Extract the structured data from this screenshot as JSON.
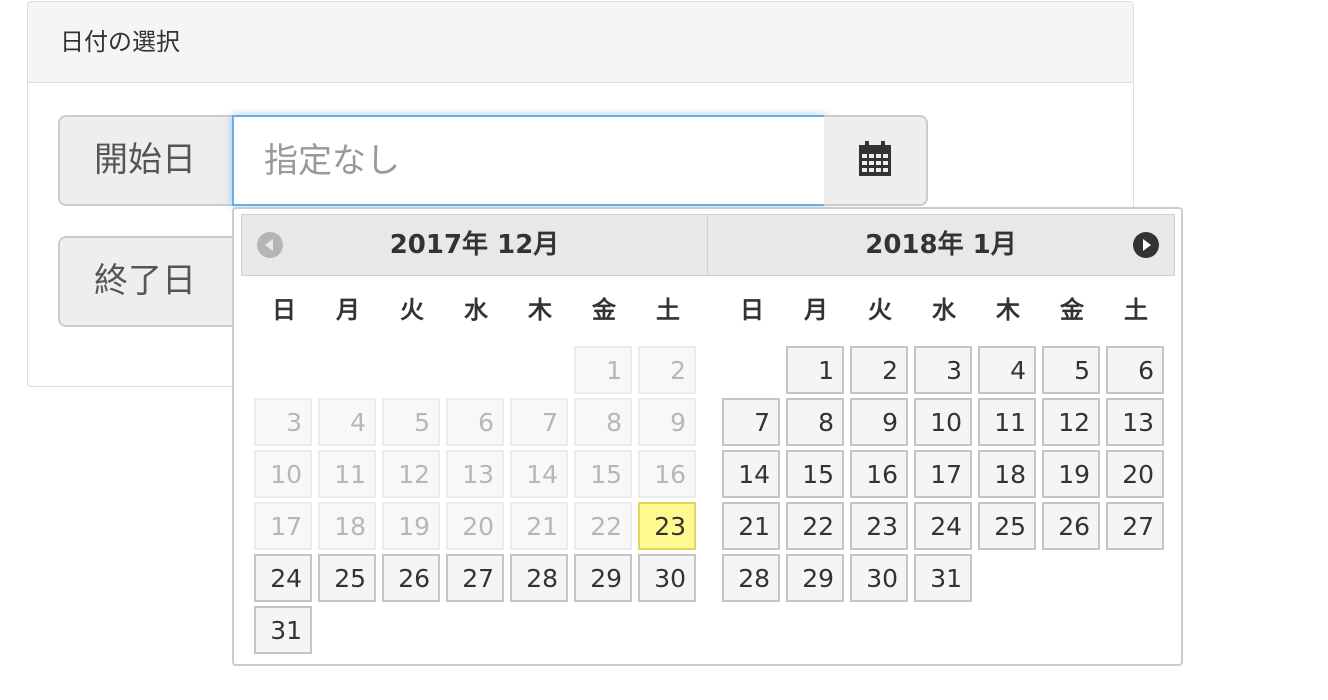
{
  "panel": {
    "title": "日付の選択"
  },
  "start": {
    "label": "開始日",
    "placeholder": "指定なし",
    "value": ""
  },
  "end": {
    "label": "終了日"
  },
  "calendar_button": {
    "icon": "calendar-icon"
  },
  "picker": {
    "months": [
      {
        "title": "2017年 12月",
        "weekdays": [
          "日",
          "月",
          "火",
          "水",
          "木",
          "金",
          "土"
        ],
        "first_weekday": 5,
        "days_in_month": 31,
        "disabled_before": 23,
        "today": 23
      },
      {
        "title": "2018年 1月",
        "weekdays": [
          "日",
          "月",
          "火",
          "水",
          "木",
          "金",
          "土"
        ],
        "first_weekday": 1,
        "days_in_month": 31,
        "disabled_before": 0,
        "today": 0
      }
    ],
    "prev_icon": "prev-arrow-icon",
    "next_icon": "next-arrow-icon"
  },
  "colors": {
    "focus_border": "#66afe9",
    "today_highlight": "#fff98f",
    "disabled_text": "#b7b7b7"
  }
}
